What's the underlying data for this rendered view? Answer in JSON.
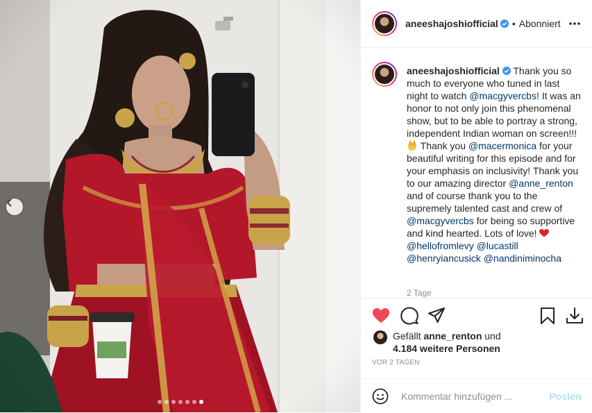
{
  "post": {
    "username": "aneeshajoshiofficial",
    "follow_status": "Abonniert",
    "separator": "•",
    "icons": {
      "verified": "verified-badge-icon",
      "more": "more-options-icon",
      "like": "heart-filled-icon",
      "comment": "comment-bubble-icon",
      "share": "paper-plane-icon",
      "save": "bookmark-icon",
      "download": "download-icon",
      "emoji": "smiley-icon",
      "prev": "chevron-left-icon"
    },
    "colors": {
      "like": "#ed4956",
      "link": "#00376b",
      "verified": "#3897f0",
      "post_button": "#b2dffc"
    },
    "carousel": {
      "slide_count": 7,
      "active_index": 6
    }
  },
  "caption": {
    "username": "aneeshajoshiofficial",
    "t1": " Thank you so much to everyone who tuned in last night to watch ",
    "m1": "@macgyvercbs",
    "t2": "! It was an honor to not only join this phenomenal show, but to be able to portray a strong, independent Indian woman on screen!!! ",
    "t3": " Thank you ",
    "m2": "@macermonica",
    "t4": " for your beautiful writing for this episode and for your emphasis on inclusivity! Thank you to our amazing director ",
    "m3": "@anne_renton",
    "t5": " and of course thank you to the supremely talented cast and crew of ",
    "m4": "@macgyvercbs",
    "t6": " for being so supportive and kind hearted. Lots of love! ",
    "m5": "@hellofromlevy",
    "m6": "@lucastill",
    "m7": "@henryiancusick",
    "m8": "@nandiniminocha",
    "time": "2 Tage"
  },
  "likes": {
    "prefix": "Gefällt ",
    "user": "anne_renton",
    "and": " und",
    "count": "4.184 weitere Personen"
  },
  "age": "VOR 2 TAGEN",
  "comment": {
    "placeholder": "Kommentar hinzufügen ...",
    "post_label": "Posten"
  }
}
